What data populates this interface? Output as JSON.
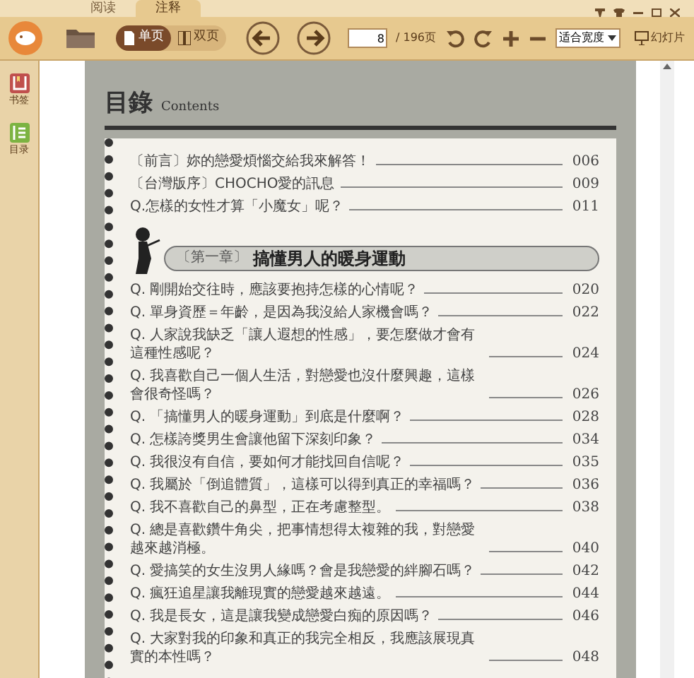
{
  "tabs": [
    {
      "label": "阅读",
      "selected": false
    },
    {
      "label": "注释",
      "selected": true
    }
  ],
  "toolbar": {
    "view_modes": [
      {
        "label": "单页",
        "selected": true
      },
      {
        "label": "双页",
        "selected": false
      }
    ],
    "page_input": "8",
    "page_total": "/ 196页",
    "zoom_select": "适合宽度",
    "slideshow": "幻灯片"
  },
  "sidebar": {
    "items": [
      {
        "label": "书签",
        "kind": "bookmark"
      },
      {
        "label": "目录",
        "kind": "toc"
      }
    ]
  },
  "page": {
    "title": "目錄",
    "subtitle": "Contents",
    "intro": [
      {
        "text": "〔前言〕妳的戀愛煩惱交給我來解答！",
        "page": "006"
      },
      {
        "text": "〔台灣版序〕CHOCHO愛的訊息",
        "page": "009"
      },
      {
        "text": "Q.怎樣的女性才算「小魔女」呢？",
        "page": "011"
      }
    ],
    "chapter": {
      "number": "〔第一章〕",
      "title": "搞懂男人的暖身運動"
    },
    "entries": [
      {
        "text": "Q. 剛開始交往時，應該要抱持怎樣的心情呢？",
        "page": "020"
      },
      {
        "text": "Q. 單身資歷＝年齡，是因為我沒給人家機會嗎？",
        "page": "022"
      },
      {
        "text": "Q. 人家說我缺乏「讓人遐想的性感」，要怎麼做才會有這種性感呢？",
        "page": "024"
      },
      {
        "text": "Q. 我喜歡自己一個人生活，對戀愛也沒什麼興趣，這樣會很奇怪嗎？",
        "page": "026"
      },
      {
        "text": "Q. 「搞懂男人的暖身運動」到底是什麼啊？",
        "page": "028"
      },
      {
        "text": "Q. 怎樣誇獎男生會讓他留下深刻印象？",
        "page": "034"
      },
      {
        "text": "Q. 我很沒有自信，要如何才能找回自信呢？",
        "page": "035"
      },
      {
        "text": "Q. 我屬於「倒追體質」，這樣可以得到真正的幸福嗎？",
        "page": "036"
      },
      {
        "text": "Q. 我不喜歡自己的鼻型，正在考慮整型。",
        "page": "038"
      },
      {
        "text": "Q. 總是喜歡鑽牛角尖，把事情想得太複雜的我，對戀愛越來越消極。",
        "page": "040"
      },
      {
        "text": "Q. 愛搞笑的女生沒男人緣嗎？會是我戀愛的絆腳石嗎？",
        "page": "042"
      },
      {
        "text": "Q. 瘋狂追星讓我離現實的戀愛越來越遠。",
        "page": "044"
      },
      {
        "text": "Q. 我是長女，這是讓我變成戀愛白痴的原因嗎？",
        "page": "046"
      },
      {
        "text": "Q. 大家對我的印象和真正的我完全相反，我應該展現真實的本性嗎？",
        "page": "048"
      }
    ]
  }
}
